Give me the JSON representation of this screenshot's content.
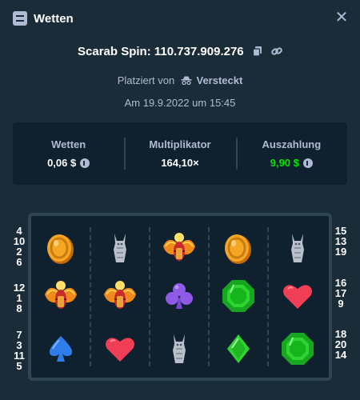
{
  "header": {
    "title": "Wetten",
    "icon": "bet-slip-icon",
    "close_icon": "close-icon"
  },
  "bet": {
    "game_label": "Scarab Spin: 110.737.909.276",
    "copy_icon": "copy-icon",
    "link_icon": "link-icon",
    "placed_prefix": "Platziert von",
    "user": "Versteckt",
    "user_icon": "incognito-icon",
    "date": "Am 19.9.2022 um 15:45"
  },
  "stats": {
    "wager_label": "Wetten",
    "wager_value": "0,06 $",
    "multiplier_label": "Multiplikator",
    "multiplier_value": "164,10×",
    "payout_label": "Auszahlung",
    "payout_value": "9,90 $",
    "coin_icon": "litecoin-icon",
    "payout_color": "#00e701"
  },
  "paylines": {
    "left": [
      [
        "4",
        "10",
        "2",
        "6"
      ],
      [
        "12",
        "1",
        "8"
      ],
      [
        "7",
        "3",
        "11",
        "5"
      ]
    ],
    "right": [
      [
        "15",
        "13",
        "19"
      ],
      [
        "16",
        "17",
        "9"
      ],
      [
        "18",
        "20",
        "14"
      ]
    ]
  },
  "grid": [
    [
      "coin",
      "anubis",
      "scarab",
      "coin",
      "anubis"
    ],
    [
      "scarab",
      "scarab",
      "club",
      "emerald",
      "heart"
    ],
    [
      "spade",
      "heart",
      "anubis",
      "diamond",
      "emerald"
    ]
  ],
  "colors": {
    "background": "#1a2c38",
    "panel": "#0f212e",
    "border": "#2f4553",
    "muted": "#b1bad3"
  }
}
